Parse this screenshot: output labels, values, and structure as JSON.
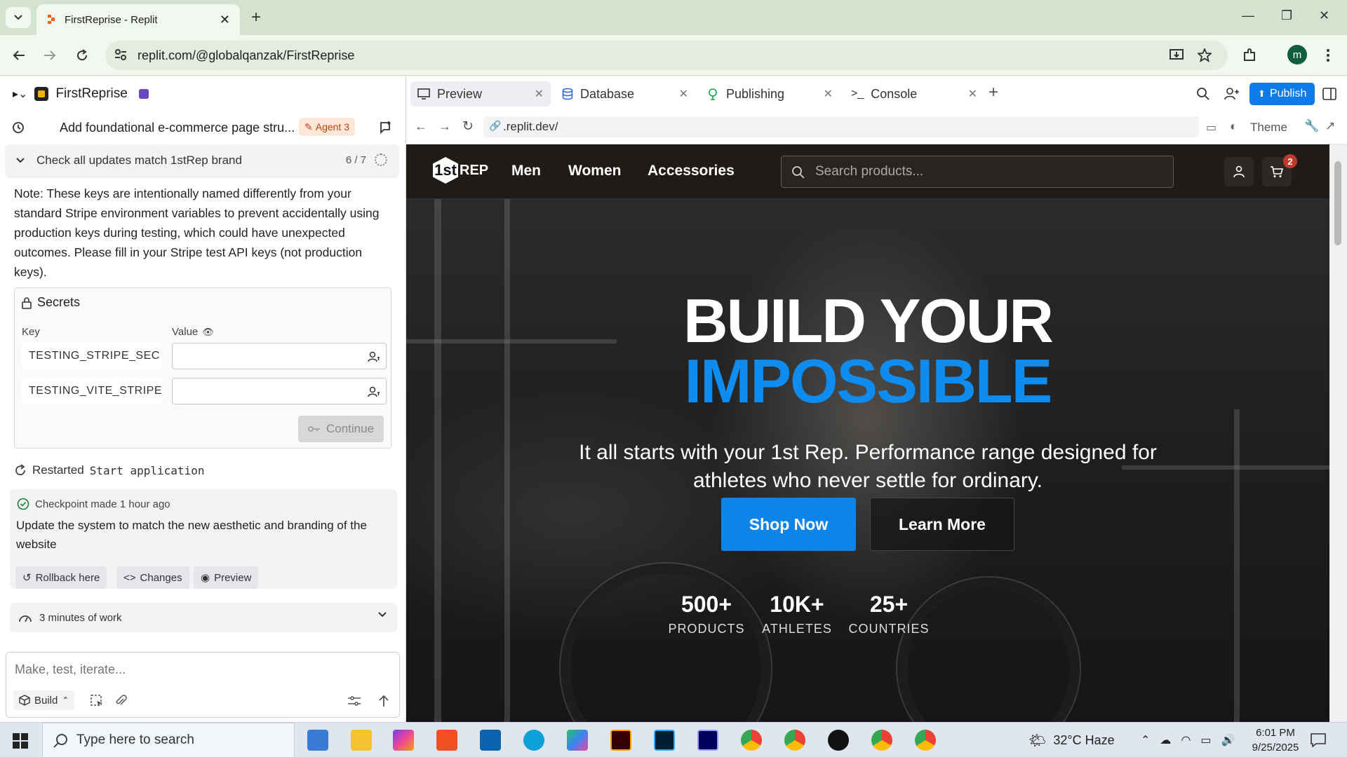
{
  "browser": {
    "tab_title": "FirstReprise - Replit",
    "url": "replit.com/@globalqanzak/FirstReprise",
    "profile_initial": "m"
  },
  "replit": {
    "project_name": "FirstReprise",
    "thread_title": "Add foundational e-commerce page stru...",
    "agent_badge": "Agent 3",
    "task": {
      "label": "Check all updates match 1stRep brand",
      "progress": "6 / 7"
    },
    "note": "Note: These keys are intentionally named differently from your standard Stripe environment variables to prevent accidentally using production keys during testing, which could have unexpected outcomes. Please fill in your Stripe test API keys (not production keys).",
    "secrets": {
      "title": "Secrets",
      "key_label": "Key",
      "value_label": "Value",
      "rows": [
        {
          "key": "TESTING_STRIPE_SEC",
          "value": ""
        },
        {
          "key": "TESTING_VITE_STRIPE",
          "value": ""
        }
      ],
      "continue_label": "Continue"
    },
    "restarted": {
      "prefix": "Restarted",
      "command": "Start application"
    },
    "checkpoint": {
      "header": "Checkpoint made 1 hour ago",
      "text": "Update the system to match the new aesthetic and branding of the website",
      "buttons": [
        "Rollback here",
        "Changes",
        "Preview"
      ]
    },
    "work": "3 minutes of work",
    "composer": {
      "placeholder": "Make, test, iterate...",
      "mode": "Build"
    },
    "pane_tabs": [
      "Preview",
      "Database",
      "Publishing",
      "Console"
    ],
    "publish_label": "Publish",
    "preview_url": ".replit.dev/",
    "theme_label": "Theme"
  },
  "site": {
    "logo_text": "REP",
    "logo_mark": "1st",
    "nav": [
      "Men",
      "Women",
      "Accessories"
    ],
    "search_placeholder": "Search products...",
    "cart_count": "2",
    "hero_line1": "BUILD YOUR",
    "hero_line2": "IMPOSSIBLE",
    "hero_sub": "It all starts with your 1st Rep. Performance range designed for athletes who never settle for ordinary.",
    "cta_primary": "Shop Now",
    "cta_secondary": "Learn More",
    "stats": [
      {
        "num": "500+",
        "label": "PRODUCTS"
      },
      {
        "num": "10K+",
        "label": "ATHLETES"
      },
      {
        "num": "25+",
        "label": "COUNTRIES"
      }
    ],
    "accent_color": "#0e8cf0"
  },
  "taskbar": {
    "search_placeholder": "Type here to search",
    "weather": "32°C  Haze",
    "time": "6:01 PM",
    "date": "9/25/2025"
  }
}
